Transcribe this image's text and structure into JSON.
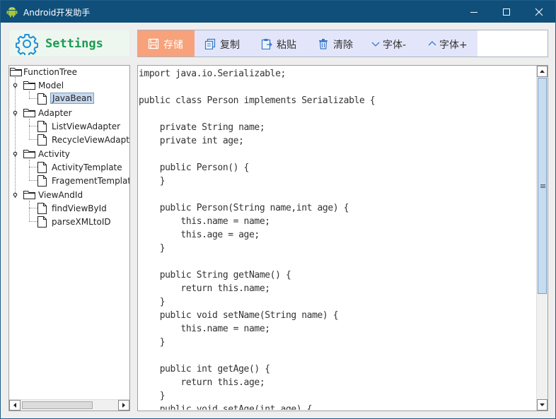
{
  "window": {
    "title": "Android开发助手",
    "controls": [
      "minimize",
      "maximize",
      "close"
    ]
  },
  "settings": {
    "label": "Settings",
    "icon": "gear-icon"
  },
  "toolbar": {
    "buttons": [
      {
        "label": "存储",
        "icon": "save-icon",
        "active": true
      },
      {
        "label": "复制",
        "icon": "copy-icon"
      },
      {
        "label": "粘贴",
        "icon": "paste-icon"
      },
      {
        "label": "清除",
        "icon": "trash-icon"
      },
      {
        "label": "字体-",
        "icon": "chevron-down-icon"
      },
      {
        "label": "字体+",
        "icon": "chevron-up-icon"
      }
    ]
  },
  "tree": {
    "root": "FunctionTree",
    "groups": [
      {
        "label": "Model",
        "items": [
          "JavaBean"
        ]
      },
      {
        "label": "Adapter",
        "items": [
          "ListViewAdapter",
          "RecycleViewAdapter"
        ]
      },
      {
        "label": "Activity",
        "items": [
          "ActivityTemplate",
          "FragementTemplate"
        ]
      },
      {
        "label": "ViewAndId",
        "items": [
          "findViewById",
          "parseXMLtoID"
        ]
      }
    ],
    "selected": "JavaBean"
  },
  "editor": {
    "lines": [
      "import java.io.Serializable;",
      "",
      "public class Person implements Serializable {",
      "",
      "    private String name;",
      "    private int age;",
      "",
      "    public Person() {",
      "    }",
      "",
      "    public Person(String name,int age) {",
      "        this.name = name;",
      "        this.age = age;",
      "    }",
      "",
      "    public String getName() {",
      "        return this.name;",
      "    }",
      "    public void setName(String name) {",
      "        this.name = name;",
      "    }",
      "",
      "    public int getAge() {",
      "        return this.age;",
      "    }",
      "    public void setAge(int age) {"
    ]
  },
  "colors": {
    "titlebar": "#0f4f7a",
    "save_active": "#f7a27b",
    "toolbar_strip": "#e3e6fa",
    "settings_green": "#1e9a53"
  }
}
